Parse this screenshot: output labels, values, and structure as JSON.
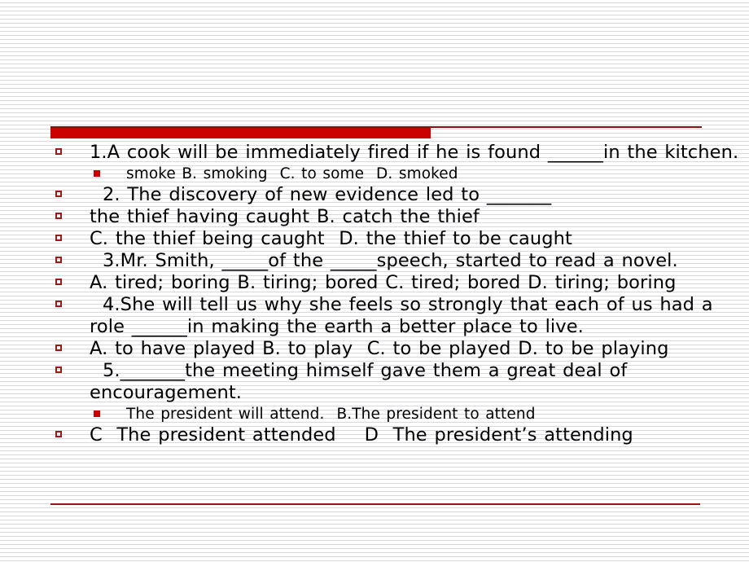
{
  "slide": {
    "background": "#ffffff",
    "pinstripe_color": "#d8d8dd",
    "accent_bar_color": "#cc0000",
    "accent_rule_color": "#8c1010",
    "marker_outline_color": "#9b1b1b",
    "text_color": "#000000"
  },
  "decorations": {
    "title_bar": "red-accent-bar",
    "title_rule": "dark-red-hairline",
    "bottom_rule": "dark-red-hairline"
  },
  "lines": [
    {
      "level": 1,
      "marker": "hollow-square-bullet",
      "text": "1.A cook will be immediately fired if he is found ______in the kitchen."
    },
    {
      "level": 2,
      "marker": "filled-square-bullet",
      "text": "smoke B. smoking  C. to some  D. smoked"
    },
    {
      "level": 1,
      "marker": "hollow-square-bullet",
      "text": "  2. The discovery of new evidence led to _______"
    },
    {
      "level": 1,
      "marker": "hollow-square-bullet",
      "text": "the thief having caught B. catch the thief"
    },
    {
      "level": 1,
      "marker": "hollow-square-bullet",
      "text": "C. the thief being caught  D. the thief to be caught"
    },
    {
      "level": 1,
      "marker": "hollow-square-bullet",
      "text": "  3.Mr. Smith, _____of the _____speech, started to read a novel."
    },
    {
      "level": 1,
      "marker": "hollow-square-bullet",
      "text": "A. tired; boring B. tiring; bored C. tired; bored D. tiring; boring"
    },
    {
      "level": 1,
      "marker": "hollow-square-bullet",
      "text": "  4.She will tell us why she feels so strongly that each of us had a role ______in making the earth a better place to live."
    },
    {
      "level": 1,
      "marker": "hollow-square-bullet",
      "text": "A. to have played B. to play  C. to be played D. to be playing"
    },
    {
      "level": 1,
      "marker": "hollow-square-bullet",
      "text": "  5._______the meeting himself gave them a great deal of encouragement."
    },
    {
      "level": 2,
      "marker": "filled-square-bullet",
      "text": "The president will attend.  B.The president to attend"
    },
    {
      "level": 1,
      "marker": "hollow-square-bullet",
      "text": "C  The president attended    D  The president’s attending"
    }
  ]
}
